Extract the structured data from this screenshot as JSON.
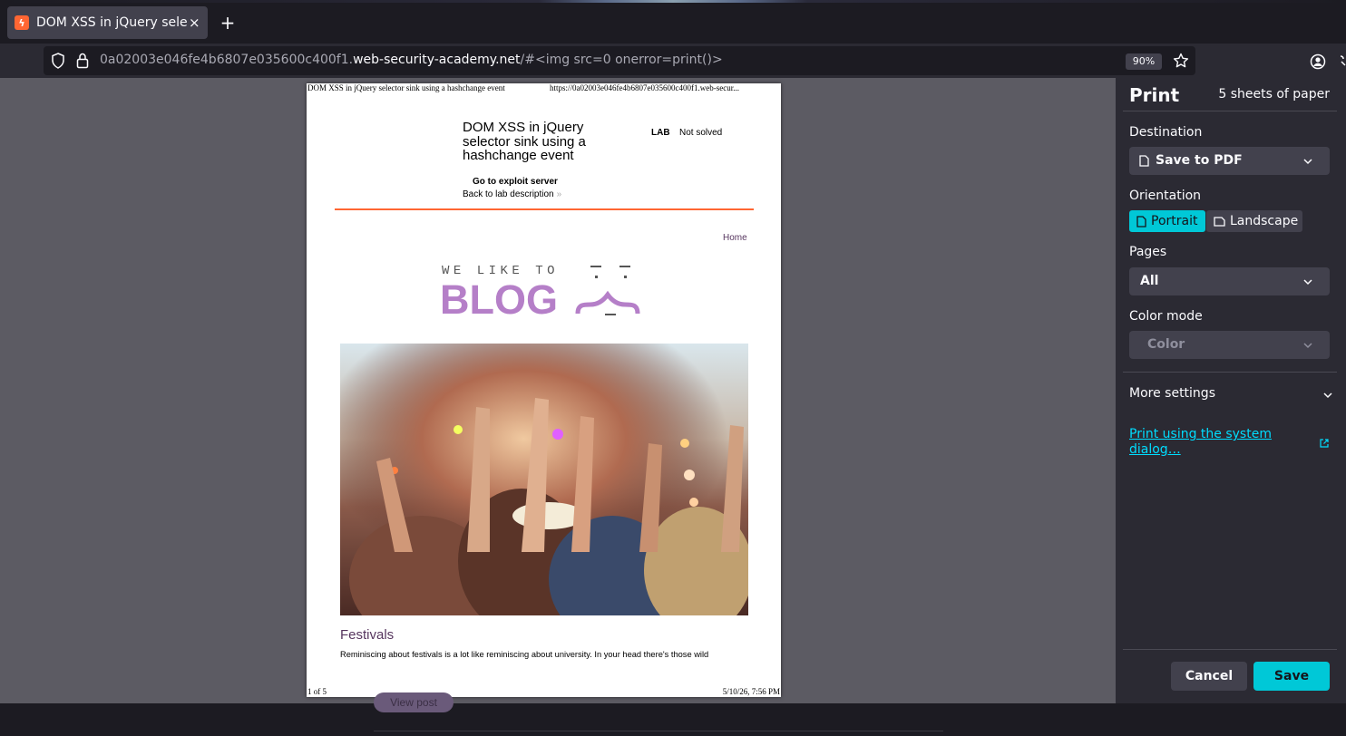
{
  "browser": {
    "tab_title": "DOM XSS in jQuery selector sink using a hashchange event",
    "tab_close": "×",
    "new_tab": "+",
    "url_prefix": "0a02003e046fe4b6807e035600c400f1.",
    "url_domain": "web-security-academy.net",
    "url_suffix": "/#<img src=0 onerror=print()>",
    "zoom": "90%"
  },
  "behind_page": {
    "view_post": "View post"
  },
  "preview": {
    "header_left": "DOM XSS in jQuery selector sink using a hashchange event",
    "header_right": "https://0a02003e046fe4b6807e035600c400f1.web-secur...",
    "footer_left": "1 of 5",
    "footer_right": "5/10/26, 7:56 PM",
    "lab_title": "DOM XSS in jQuery selector sink using a hashchange event",
    "lab_badge": "LAB",
    "lab_status": "Not solved",
    "exploit_link": "Go to exploit server",
    "back_link": "Back to lab description",
    "back_chevron": "»",
    "home_link": "Home",
    "logo_top": "WE LIKE TO",
    "logo_main": "BLOG",
    "post_title": "Festivals",
    "post_excerpt": "Reminiscing about festivals is a lot like reminiscing about university. In your head there's those wild"
  },
  "print": {
    "title": "Print",
    "sheets": "5 sheets of paper",
    "destination_label": "Destination",
    "destination_value": "Save to PDF",
    "orientation_label": "Orientation",
    "orientation_portrait": "Portrait",
    "orientation_landscape": "Landscape",
    "pages_label": "Pages",
    "pages_value": "All",
    "color_label": "Color mode",
    "color_value": "Color",
    "more_settings": "More settings",
    "system_dialog": "Print using the system dialog…",
    "cancel": "Cancel",
    "save": "Save"
  },
  "colors": {
    "accent": "#00c8d7",
    "link": "#00ddff",
    "lab_rule": "#ff6633",
    "blog_purple": "#57365f",
    "logo_purple": "#b57fc8"
  }
}
